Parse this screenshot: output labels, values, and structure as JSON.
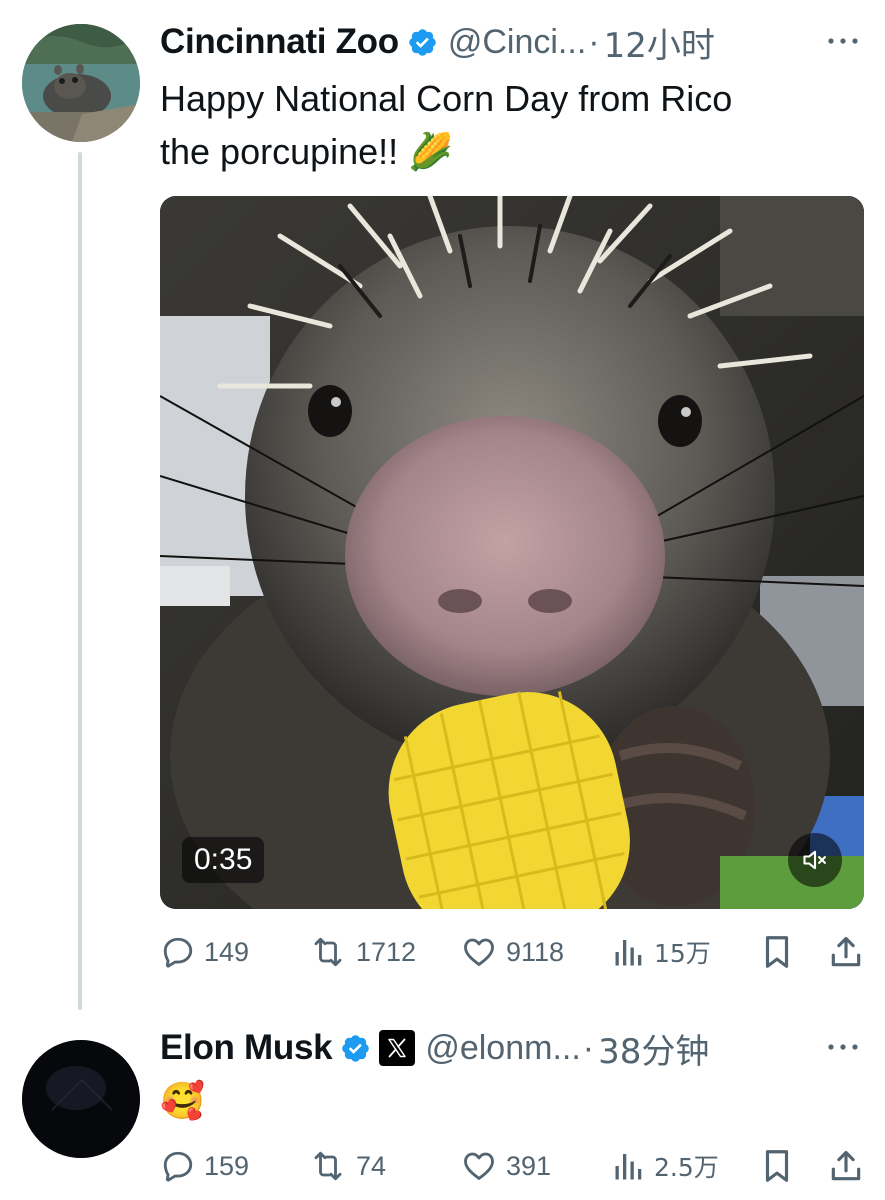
{
  "tweets": [
    {
      "author": {
        "name": "Cincinnati Zoo",
        "handle": "@Cinci...",
        "verified": true,
        "avatar_icon": "hippo-photo-avatar"
      },
      "separator": "·",
      "time": "12小时",
      "text": "Happy National Corn Day from Rico\nthe porcupine!! 🌽",
      "media": {
        "type": "video",
        "duration": "0:35",
        "muted": true,
        "description_icon": "porcupine-eating-corn-video"
      },
      "stats": {
        "replies": "149",
        "retweets": "1712",
        "likes": "9118",
        "views": "15万"
      }
    },
    {
      "author": {
        "name": "Elon Musk",
        "handle": "@elonm...",
        "verified": true,
        "affiliate_badge": "x-logo-icon",
        "avatar_icon": "dark-avatar"
      },
      "separator": "·",
      "time": "38分钟",
      "text": "🥰",
      "stats": {
        "replies": "159",
        "retweets": "74",
        "likes": "391",
        "views": "2.5万"
      }
    }
  ],
  "colors": {
    "verified_blue": "#1d9bf0",
    "secondary_text": "#536471",
    "thread_line": "#cfd9de",
    "primary_text": "#0f1419"
  }
}
